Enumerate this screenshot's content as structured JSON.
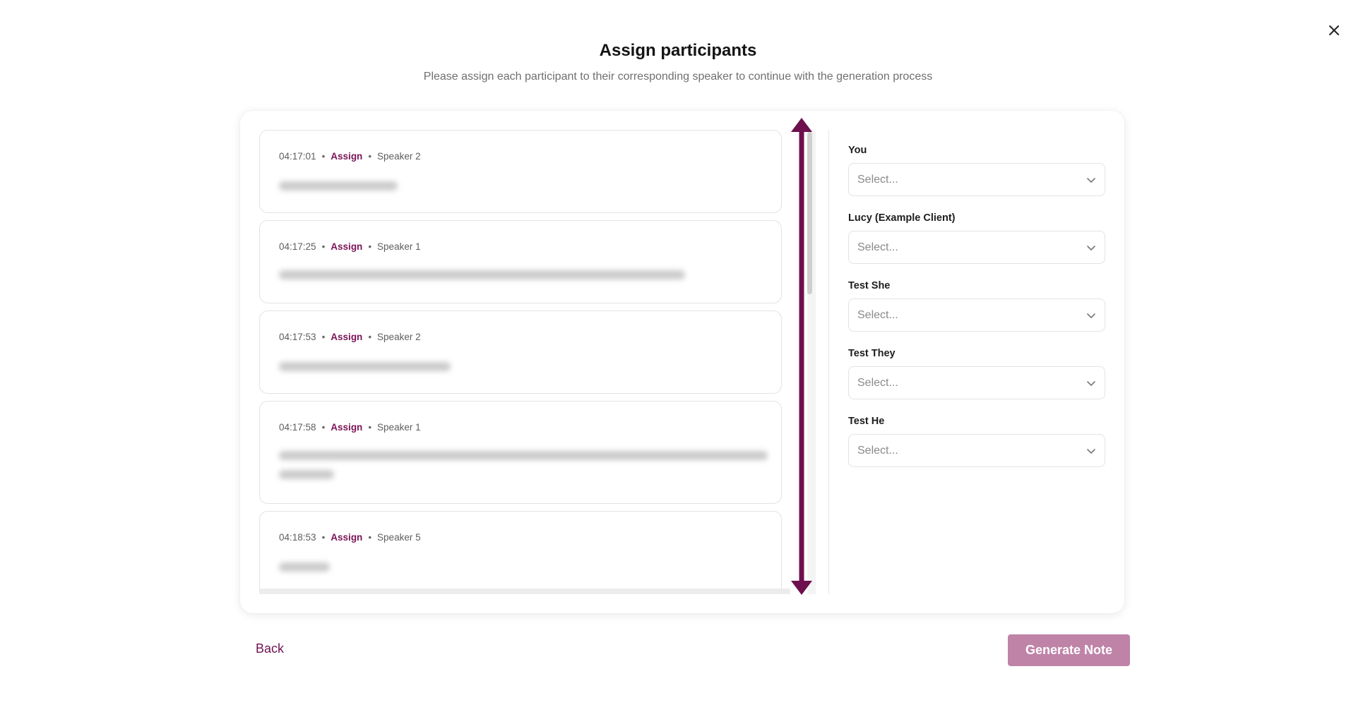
{
  "modal": {
    "title": "Assign participants",
    "subtitle": "Please assign each participant to their corresponding speaker to continue with the generation process"
  },
  "segments": [
    {
      "time": "04:17:01",
      "assign_label": "Assign",
      "speaker": "Speaker 2"
    },
    {
      "time": "04:17:25",
      "assign_label": "Assign",
      "speaker": "Speaker 1"
    },
    {
      "time": "04:17:53",
      "assign_label": "Assign",
      "speaker": "Speaker 2"
    },
    {
      "time": "04:17:58",
      "assign_label": "Assign",
      "speaker": "Speaker 1"
    },
    {
      "time": "04:18:53",
      "assign_label": "Assign",
      "speaker": "Speaker 5"
    }
  ],
  "participants": [
    {
      "label": "You",
      "placeholder": "Select..."
    },
    {
      "label": "Lucy (Example Client)",
      "placeholder": "Select..."
    },
    {
      "label": "Test She",
      "placeholder": "Select..."
    },
    {
      "label": "Test They",
      "placeholder": "Select..."
    },
    {
      "label": "Test He",
      "placeholder": "Select..."
    }
  ],
  "footer": {
    "back_label": "Back",
    "generate_label": "Generate Note"
  },
  "colors": {
    "accent": "#7a1556",
    "generate_button": "#bf83a8",
    "arrow": "#6e0f4e"
  },
  "icons": {
    "close": "close-icon",
    "dropdown": "chevron-down-icon",
    "scroll_arrow": "double-arrow-icon"
  }
}
